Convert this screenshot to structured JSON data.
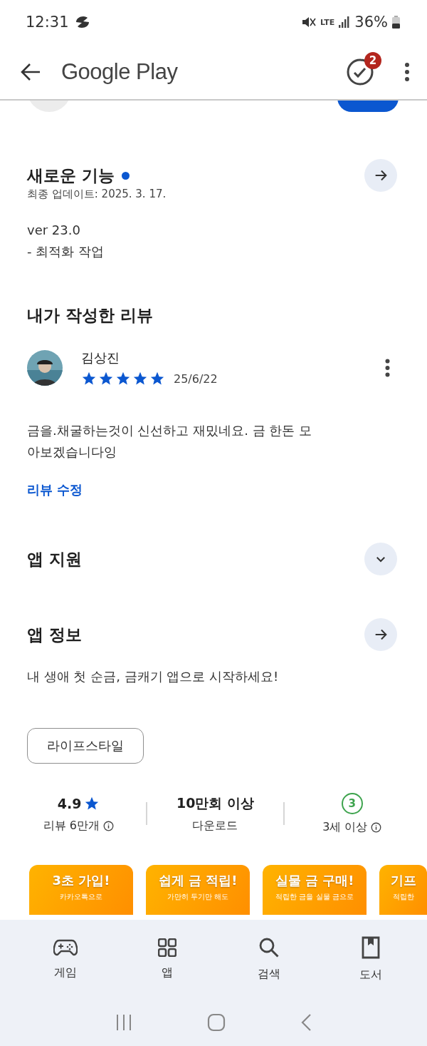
{
  "status_bar": {
    "time": "12:31",
    "network": "LTE",
    "battery": "36%"
  },
  "app_bar": {
    "title": "Google Play",
    "badge": "2"
  },
  "whats_new": {
    "title": "새로운 기능",
    "updated": "최종 업데이트: 2025. 3. 17.",
    "lines": [
      "ver 23.0",
      "- 최적화 작업"
    ]
  },
  "my_review": {
    "title": "내가 작성한 리뷰",
    "author": "김상진",
    "stars": 5,
    "date": "25/6/22",
    "text": "금을.채굴하는것이 신선하고 재밌네요. 금 한돈 모아보겠습니다잉",
    "edit_link": "리뷰 수정"
  },
  "sections": [
    {
      "title": "앱 지원",
      "kind": "expand"
    },
    {
      "title": "앱 정보",
      "kind": "arrow"
    }
  ],
  "about": {
    "description": "내 생애 첫 순금, 금캐기 앱으로 시작하세요!",
    "chip": "라이프스타일"
  },
  "stats": [
    {
      "kind": "rating",
      "value": "4.9",
      "label": "리뷰 6만개"
    },
    {
      "kind": "plain",
      "value": "10만회 이상",
      "label": "다운로드"
    },
    {
      "kind": "age",
      "value": "3",
      "label": "3세 이상"
    }
  ],
  "screenshots": [
    {
      "title": "3초 가입!",
      "caption": "카카오톡으로"
    },
    {
      "title": "쉽게 금 적립!",
      "caption": "가만히 두기만 해도"
    },
    {
      "title": "실물 금 구매!",
      "caption": "적립한 금을 실물 금으로"
    },
    {
      "title": "기프",
      "caption": "적립한"
    }
  ],
  "bottom_nav": [
    {
      "label": "게임"
    },
    {
      "label": "앱"
    },
    {
      "label": "검색"
    },
    {
      "label": "도서"
    }
  ]
}
